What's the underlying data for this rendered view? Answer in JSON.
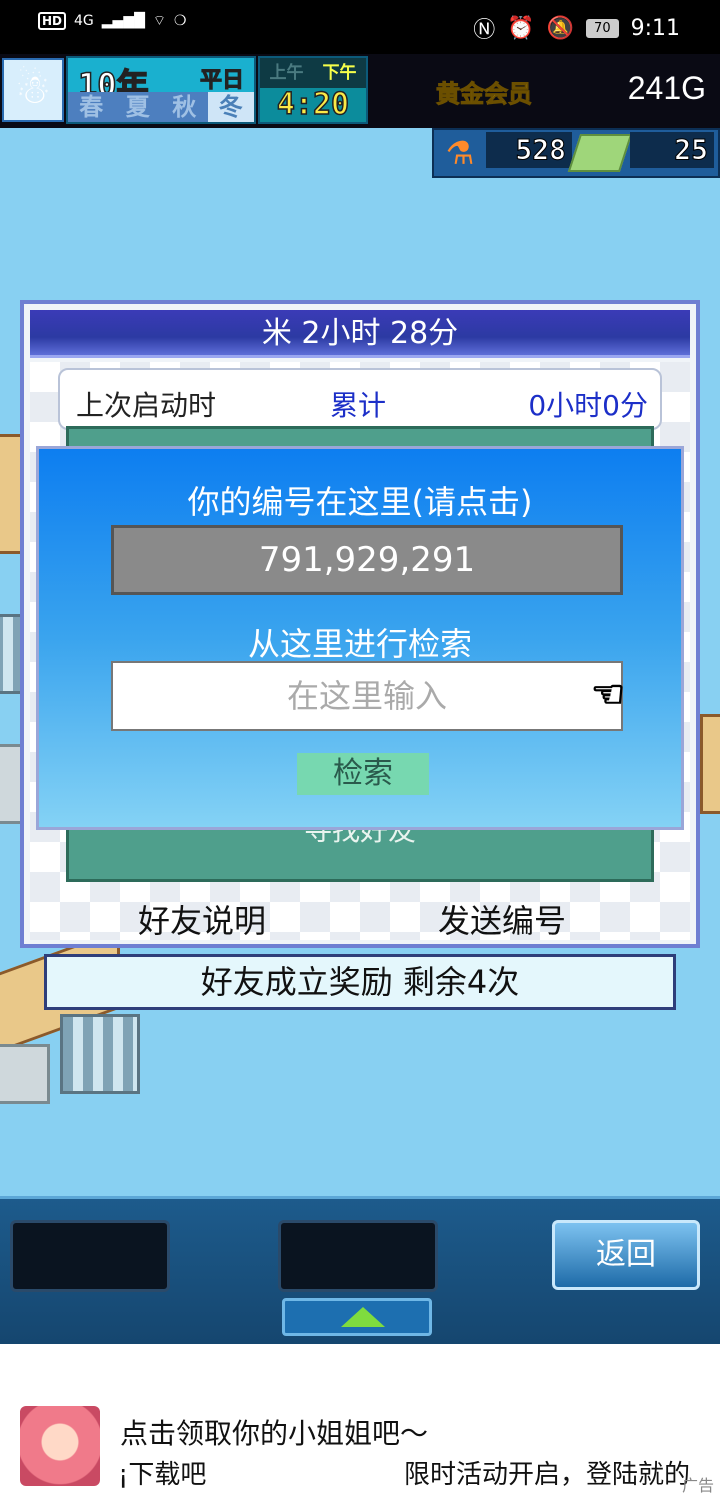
{
  "status_bar": {
    "hd": "HD",
    "network": "4G",
    "battery": "70",
    "time": "9:11"
  },
  "hud": {
    "year": "10年",
    "weekday": "平日",
    "seasons": [
      "春",
      "夏",
      "秋",
      "冬"
    ],
    "active_season_index": 3,
    "am": "上午",
    "pm": "下午",
    "clock": "4:20",
    "membership": "黄金会员",
    "money": "241G",
    "research_points": "528",
    "tickets": "25"
  },
  "friend_panel": {
    "title": "米  2小时 28分",
    "last_launch_label": "上次启动时",
    "total_label": "累计",
    "total_value": "0小时0分",
    "find_friend": "寻找好友",
    "friend_info": "好友说明",
    "send_id": "发送编号"
  },
  "id_dialog": {
    "heading": "你的编号在这里(请点击)",
    "user_id": "791,929,291",
    "search_heading": "从这里进行检索",
    "input_placeholder": "在这里输入",
    "search_button": "检索"
  },
  "reward_bar": "好友成立奖励  剩余4次",
  "toolbar": {
    "back_button": "返回"
  },
  "ad": {
    "title": "点击领取你的小姐姐吧～",
    "subtitle": "¡下载吧",
    "promo": "限时活动开启，登陆就的",
    "tag": "广告"
  }
}
